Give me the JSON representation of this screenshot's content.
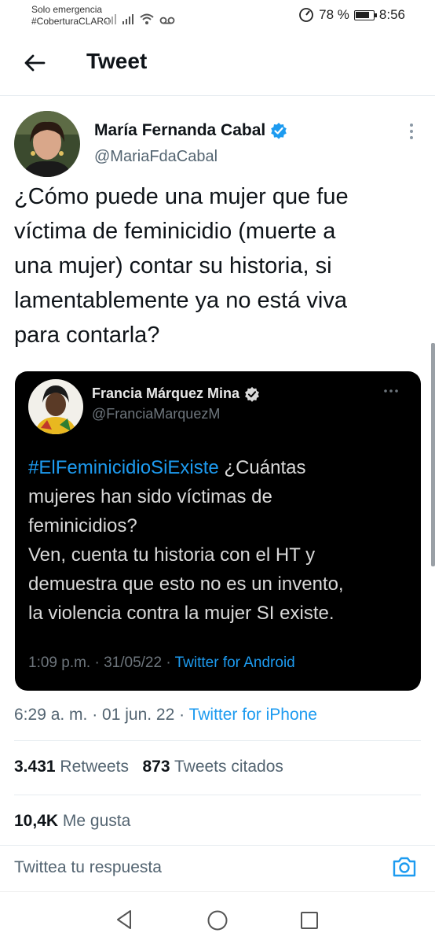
{
  "status_bar": {
    "carrier_line1": "Solo emergencia",
    "carrier_line2": "#CoberturaCLARO",
    "battery": "78 %",
    "time": "8:56"
  },
  "header": {
    "title": "Tweet",
    "back_icon": "arrow-left-icon"
  },
  "tweet": {
    "author_name": "María Fernanda Cabal",
    "author_handle": "@MariaFdaCabal",
    "text_lines": [
      "¿Cómo puede una mujer que fue",
      "víctima de feminicidio (muerte a",
      "una mujer) contar su historia, si",
      "lamentablemente ya no está viva",
      "para contarla?"
    ],
    "time": "6:29 a. m. · 01 jun. 22 · ",
    "source": "Twitter for iPhone",
    "retweets_count": "3.431",
    "retweets_label": "Retweets",
    "quotes_count": "873",
    "quotes_label": "Tweets citados",
    "likes_count": "10,4K",
    "likes_label": "Me gusta"
  },
  "embedded": {
    "author_name": "Francia Márquez Mina",
    "author_handle": "@FranciaMarquezM",
    "hashtag": "#ElFeminicidioSiExiste",
    "text_line1_rest": " ¿Cuántas",
    "text_lines": [
      "mujeres han sido víctimas de",
      "feminicidios?",
      "Ven, cuenta tu historia con el HT y",
      "demuestra que esto no es un invento,",
      "la violencia contra la mujer SI existe."
    ],
    "time": "1:09 p.m. · 31/05/22 · ",
    "source": "Twitter for Android"
  },
  "reply": {
    "placeholder": "Twittea tu respuesta"
  },
  "colors": {
    "accent": "#1d9bf0",
    "text_primary": "#0f1419",
    "text_secondary": "#536471"
  }
}
